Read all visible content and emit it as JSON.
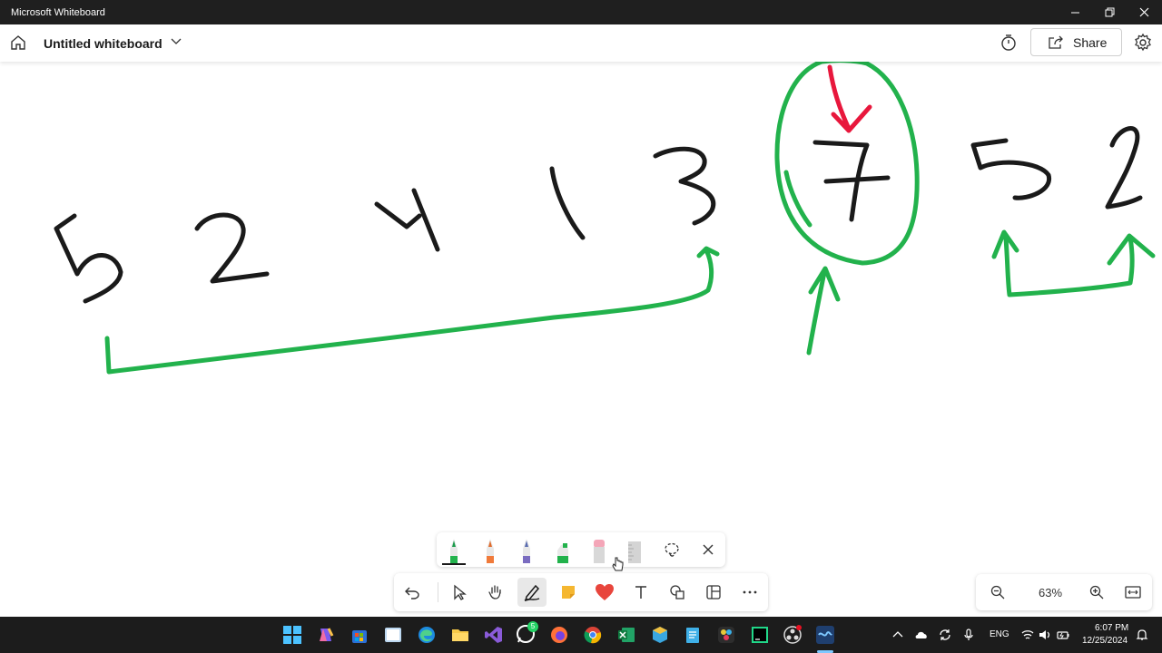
{
  "window": {
    "title": "Microsoft Whiteboard"
  },
  "header": {
    "board_title": "Untitled whiteboard",
    "share_label": "Share"
  },
  "zoom": {
    "level": "63%"
  },
  "taskbar": {
    "language": "ENG",
    "time": "6:07 PM",
    "date": "12/25/2024",
    "whatsapp_badge": "5"
  },
  "colors": {
    "ink_black": "#1a1a1a",
    "ink_green": "#22b24c",
    "ink_red": "#e8173c",
    "titlebar": "#1f1f1f",
    "taskbar": "#1c1c1c"
  },
  "ink_tray": {
    "pens": [
      "green-pen",
      "orange-pen",
      "blue-pen",
      "green-highlighter",
      "pink-eraser",
      "ruler"
    ]
  }
}
